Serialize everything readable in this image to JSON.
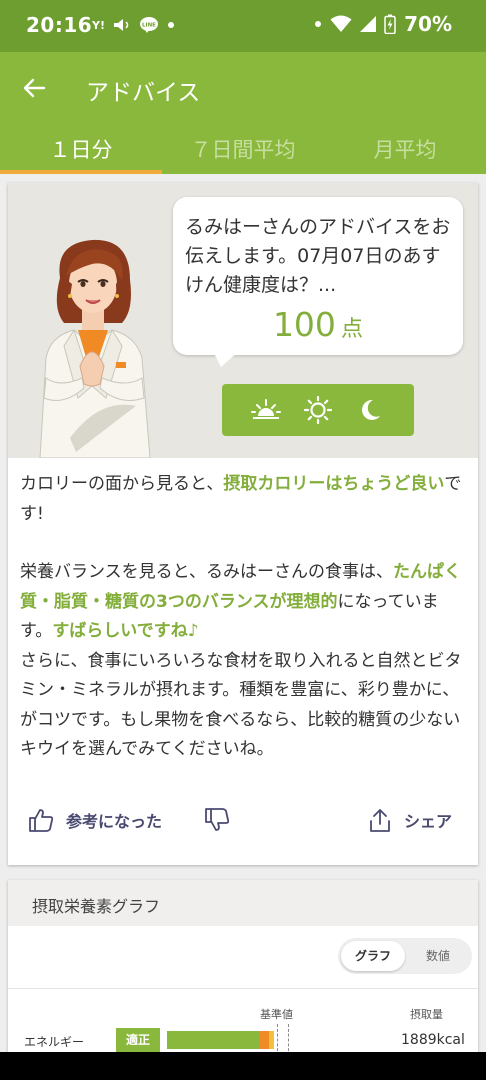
{
  "status_bar": {
    "time": "20:16",
    "left_icons": [
      "yahoo-icon",
      "speaker-icon",
      "line-icon",
      "dot-icon"
    ],
    "battery": "70%"
  },
  "app_bar": {
    "title": "アドバイス",
    "tabs": [
      {
        "label": "１日分",
        "active": true
      },
      {
        "label": "７日間平均",
        "active": false
      },
      {
        "label": "月平均",
        "active": false
      }
    ]
  },
  "advice_card": {
    "bubble_text": "るみはーさんのアドバイスをお伝えします。07月07日のあすけん健康度は？...",
    "score": "100",
    "score_unit": "点",
    "time_buttons": [
      "morning-icon",
      "noon-icon",
      "night-icon"
    ],
    "paragraph1": {
      "before": "カロリーの面から見ると、",
      "highlight": "摂取カロリーはちょうど良い",
      "after": "です!"
    },
    "paragraph2": {
      "part1": "栄養バランスを見ると、るみはーさんの食事は、",
      "highlight1": "たんぱく質・脂質・糖質の3つのバランスが理想的",
      "part2": "になっています。",
      "highlight2": "すばらしいですね♪",
      "part3": "さらに、食事にいろいろな食材を取り入れると自然とビタミン・ミネラルが摂れます。種類を豊富に、彩り豊かに、がコツです。もし果物を食べるなら、比較的糖質の少ないキウイを選んでみてくださいね。"
    },
    "helpful_label": "参考になった",
    "share_label": "シェア"
  },
  "nutrition_card": {
    "title": "摂取栄養素グラフ",
    "toggle": [
      "グラフ",
      "数値"
    ],
    "col_standard": "基準値",
    "col_intake": "摂取量",
    "rows": [
      {
        "name": "エネルギー",
        "status": "適正",
        "value": "1889kcal"
      }
    ]
  },
  "colors": {
    "status_bar": "#6e9e2f",
    "app_bar": "#8ab83c",
    "accent_green": "#84ae3b",
    "tab_indicator": "#f2a93b"
  }
}
